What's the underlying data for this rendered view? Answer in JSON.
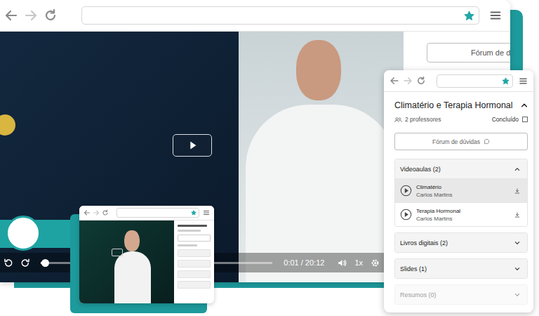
{
  "main_window": {
    "bookmarked": true,
    "forum_button": "Fórum de d",
    "player": {
      "progress": 0.01,
      "time": "0:01 / 20:12",
      "speed": "1x"
    }
  },
  "small_window": {
    "bookmarked": true
  },
  "course_window": {
    "bookmarked": true,
    "title": "Climatério e Terapia Hormonal",
    "expanded": true,
    "teachers": "2 professores",
    "done_label": "Concluído",
    "done": false,
    "forum_button": "Fórum de dúvidas",
    "sections": [
      {
        "label": "Videoaulas (2)",
        "expanded": true,
        "dimmed": false,
        "items": [
          {
            "title": "Climatério",
            "author": "Carlos Martins",
            "selected": true
          },
          {
            "title": "Terapia Hormonal",
            "author": "Carlos Martins",
            "selected": false
          }
        ]
      },
      {
        "label": "Livros digitais (2)",
        "expanded": false,
        "dimmed": false,
        "items": []
      },
      {
        "label": "Slides (1)",
        "expanded": false,
        "dimmed": false,
        "items": []
      },
      {
        "label": "Resumos (0)",
        "expanded": false,
        "dimmed": true,
        "items": []
      }
    ]
  }
}
